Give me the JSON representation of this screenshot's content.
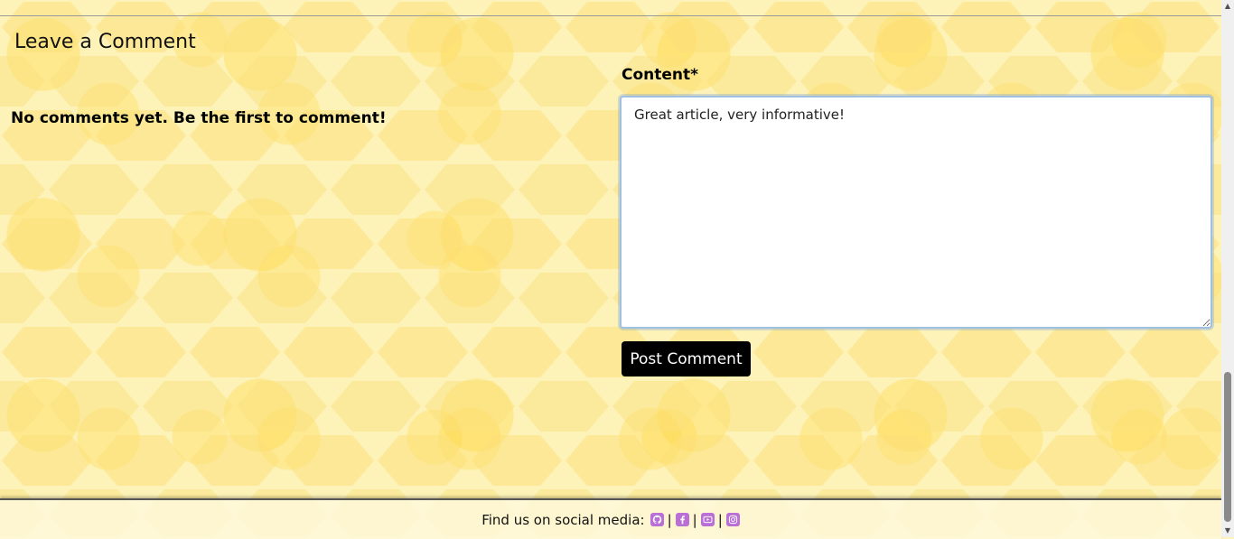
{
  "comments_section": {
    "title": "Leave a Comment",
    "empty_message": "No comments yet. Be the first to comment!"
  },
  "comment_form": {
    "content_label": "Content*",
    "content_value": "Great article, very informative!",
    "submit_label": "Post Comment"
  },
  "footer": {
    "text": "Find us on social media:",
    "separator": "|",
    "icons": [
      "github-icon",
      "facebook-icon",
      "youtube-icon",
      "instagram-icon"
    ],
    "icon_color": "#b96fd6"
  },
  "colors": {
    "background": "#fdf2b8",
    "button": "#000000",
    "button_text": "#ffffff"
  }
}
